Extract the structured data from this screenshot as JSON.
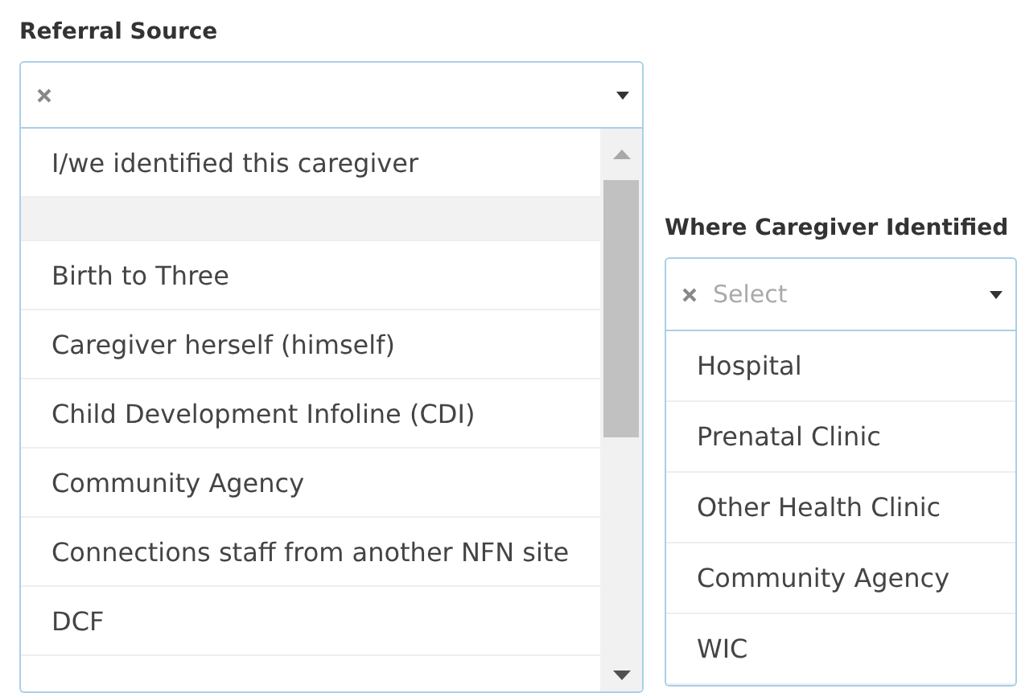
{
  "fields": [
    {
      "label": "Referral Source",
      "scrollable": true,
      "options": [
        {
          "kind": "option",
          "label": "I/we identified this caregiver",
          "selected": false
        },
        {
          "kind": "blank",
          "selected": true
        },
        {
          "kind": "option",
          "label": "Birth to Three",
          "selected": false
        },
        {
          "kind": "option",
          "label": "Caregiver herself (himself)",
          "selected": false
        },
        {
          "kind": "option",
          "label": "Child Development Infoline (CDI)",
          "selected": false
        },
        {
          "kind": "option",
          "label": "Community Agency",
          "selected": false
        },
        {
          "kind": "option",
          "label": "Connections staff from another NFN site",
          "selected": false
        },
        {
          "kind": "option",
          "label": "DCF",
          "selected": false
        }
      ]
    },
    {
      "label": "Where Caregiver Identified",
      "placeholder": "Select",
      "scrollable": false,
      "options": [
        {
          "kind": "option",
          "label": "Hospital",
          "selected": false
        },
        {
          "kind": "option",
          "label": "Prenatal Clinic",
          "selected": false
        },
        {
          "kind": "option",
          "label": "Other Health Clinic",
          "selected": false
        },
        {
          "kind": "option",
          "label": "Community Agency",
          "selected": false
        },
        {
          "kind": "option",
          "label": "WIC",
          "selected": false
        }
      ]
    }
  ]
}
